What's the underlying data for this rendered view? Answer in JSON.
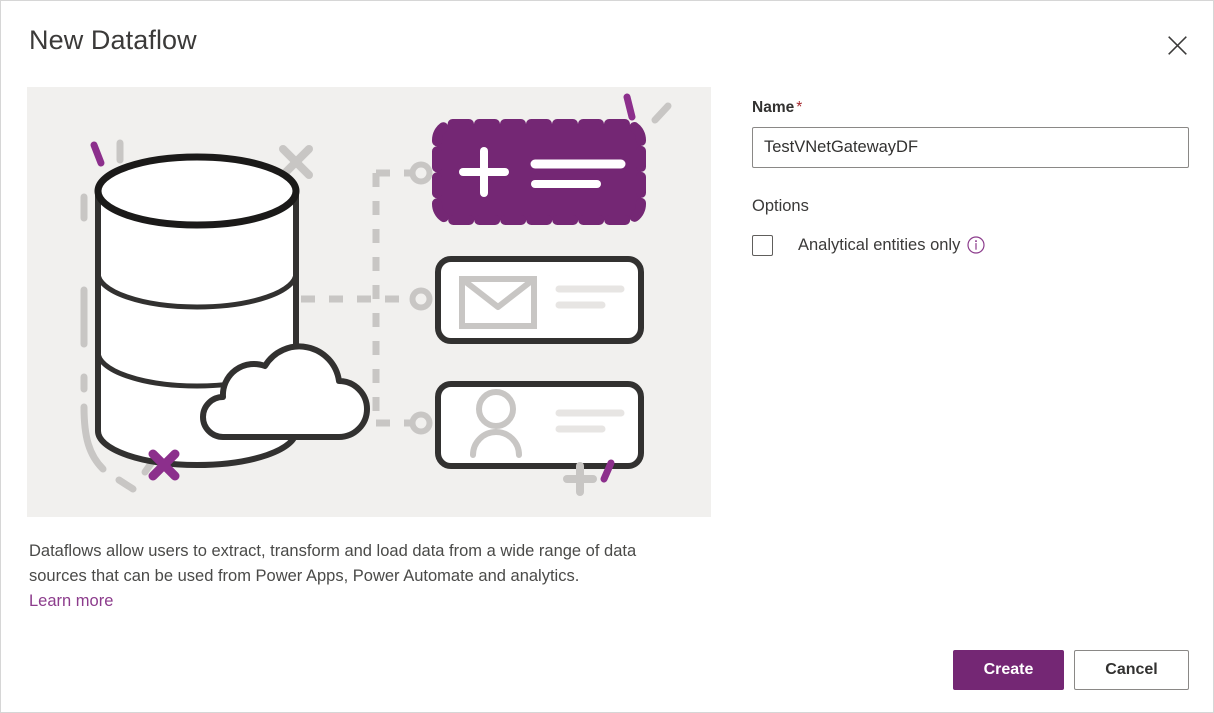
{
  "dialog": {
    "title": "New Dataflow",
    "close_icon": "close-icon"
  },
  "illustration": {
    "alt": "dataflow-illustration",
    "background_color": "#f1f0ee",
    "accent_color": "#742774",
    "outline_color": "#323130",
    "muted_color": "#c8c6c4",
    "elements": [
      "database-cylinder",
      "cloud",
      "dashed-connector",
      "purple-add-card",
      "email-entity-card",
      "person-entity-card",
      "decorative-marks"
    ]
  },
  "description": {
    "text": "Dataflows allow users to extract, transform and load data from a wide range of data sources that can be used from Power Apps, Power Automate and analytics.",
    "learn_more_label": "Learn more",
    "learn_more_color": "#8c3c8c"
  },
  "form": {
    "name": {
      "label": "Name",
      "required_marker": "*",
      "value": "TestVNetGatewayDF",
      "placeholder": ""
    },
    "options": {
      "label": "Options",
      "analytical_entities": {
        "label": "Analytical entities only",
        "checked": false,
        "info_icon": "info-icon"
      }
    }
  },
  "footer": {
    "create_label": "Create",
    "cancel_label": "Cancel",
    "create_color": "#742774"
  }
}
